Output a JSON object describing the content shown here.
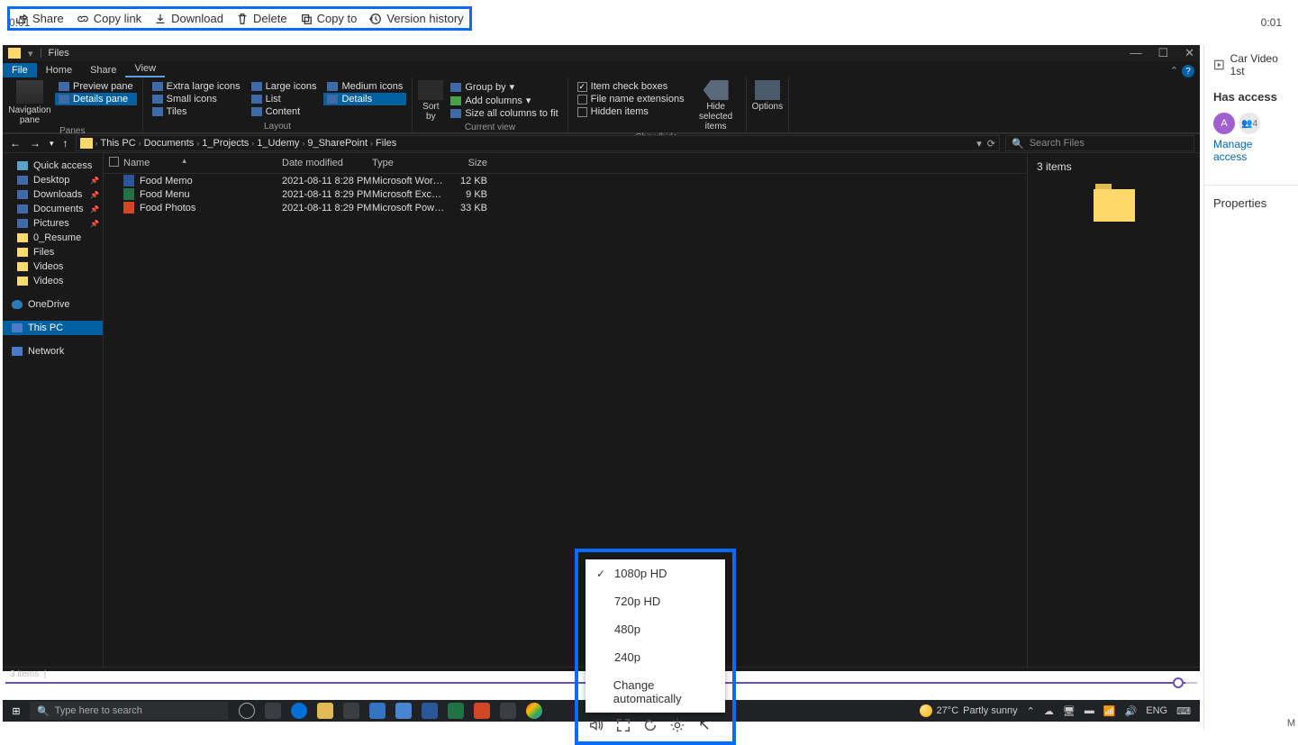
{
  "share_toolbar": {
    "share": "Share",
    "copy_link": "Copy link",
    "download": "Download",
    "delete": "Delete",
    "copy_to": "Copy to",
    "version_history": "Version history"
  },
  "explorer": {
    "title": "Files",
    "tabs": {
      "file": "File",
      "home": "Home",
      "share": "Share",
      "view": "View"
    },
    "ribbon": {
      "panes": {
        "nav": "Navigation pane",
        "preview": "Preview pane",
        "details": "Details pane",
        "label": "Panes"
      },
      "layout": {
        "xl": "Extra large icons",
        "large": "Large icons",
        "medium": "Medium icons",
        "small": "Small icons",
        "list": "List",
        "details": "Details",
        "tiles": "Tiles",
        "content": "Content",
        "label": "Layout"
      },
      "current": {
        "sort": "Sort by",
        "group": "Group by",
        "add_cols": "Add columns",
        "fit": "Size all columns to fit",
        "label": "Current view"
      },
      "showhide": {
        "item_check": "Item check boxes",
        "ext": "File name extensions",
        "hidden": "Hidden items",
        "hide_selected": "Hide selected items",
        "label": "Show/hide"
      },
      "options": {
        "options": "Options"
      }
    },
    "breadcrumb": [
      "This PC",
      "Documents",
      "1_Projects",
      "1_Udemy",
      "9_SharePoint",
      "Files"
    ],
    "search_placeholder": "Search Files",
    "sidebar": {
      "quick": "Quick access",
      "desktop": "Desktop",
      "downloads": "Downloads",
      "documents": "Documents",
      "pictures": "Pictures",
      "resume": "0_Resume",
      "files": "Files",
      "videos1": "Videos",
      "videos2": "Videos",
      "onedrive": "OneDrive",
      "thispc": "This PC",
      "network": "Network"
    },
    "columns": {
      "name": "Name",
      "date": "Date modified",
      "type": "Type",
      "size": "Size"
    },
    "rows": [
      {
        "name": "Food Memo",
        "date": "2021-08-11 8:28 PM",
        "type": "Microsoft Word D...",
        "size": "12 KB",
        "kind": "word"
      },
      {
        "name": "Food Menu",
        "date": "2021-08-11 8:29 PM",
        "type": "Microsoft Excel W...",
        "size": "9 KB",
        "kind": "excel"
      },
      {
        "name": "Food Photos",
        "date": "2021-08-11 8:29 PM",
        "type": "Microsoft PowerP...",
        "size": "33 KB",
        "kind": "ppt"
      }
    ],
    "details_count": "3 items",
    "status": "3 items"
  },
  "quality_menu": {
    "o1080": "1080p HD",
    "o720": "720p HD",
    "o480": "480p",
    "o240": "240p",
    "auto": "Change automatically"
  },
  "video": {
    "time_l": "0:01",
    "time_r": "0:01"
  },
  "taskbar": {
    "search_placeholder": "Type here to search",
    "weather_temp": "27°C",
    "weather_desc": "Partly sunny",
    "lang": "ENG"
  },
  "right_panel": {
    "title": "Car Video 1st",
    "access_heading": "Has access",
    "shared_count": "4",
    "manage": "Manage access",
    "properties": "Properties"
  }
}
